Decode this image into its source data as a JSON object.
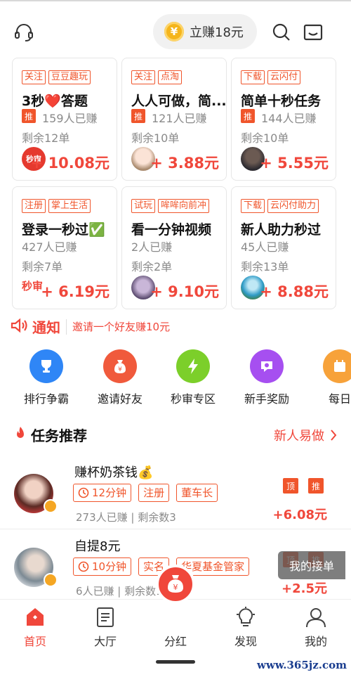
{
  "header": {
    "earn_label": "立赚18元",
    "coin_symbol": "¥"
  },
  "cards": [
    {
      "tags": [
        "关注",
        "豆豆趣玩"
      ],
      "title": "3秒❤️答题",
      "flag": "推",
      "earned": "159人已赚",
      "remaining": "剩余12单",
      "avatar_text": "秒审",
      "price": "+ 10.08元"
    },
    {
      "tags": [
        "关注",
        "点淘"
      ],
      "title": "人人可做，简...",
      "flag": "推",
      "earned": "121人已赚",
      "remaining": "剩余10单",
      "price": "+ 3.88元"
    },
    {
      "tags": [
        "下载",
        "云闪付"
      ],
      "title": "简单十秒任务",
      "flag": "推",
      "earned": "144人已赚",
      "remaining": "剩余10单",
      "price": "+ 5.55元"
    },
    {
      "tags": [
        "注册",
        "掌上生活"
      ],
      "title": "登录一秒过✅",
      "earned": "427人已赚",
      "remaining": "剩余7单",
      "avatar_text": "秒审",
      "price": "+ 6.19元"
    },
    {
      "tags": [
        "试玩",
        "哞哞向前冲"
      ],
      "title": "看一分钟视频",
      "earned": "2人已赚",
      "remaining": "剩余2单",
      "price": "+ 9.10元"
    },
    {
      "tags": [
        "下载",
        "云闪付助力"
      ],
      "title": "新人助力秒过",
      "earned": "45人已赚",
      "remaining": "剩余13单",
      "price": "+ 8.88元"
    }
  ],
  "notice": {
    "title": "通知",
    "text": "邀请一个好友赚10元"
  },
  "quick_nav": [
    {
      "label": "排行争霸",
      "color": "#2f86f6"
    },
    {
      "label": "邀请好友",
      "color": "#f05a3c"
    },
    {
      "label": "秒审专区",
      "color": "#7ccf2a"
    },
    {
      "label": "新手奖励",
      "color": "#a64ff0"
    },
    {
      "label": "每日",
      "color": "#f7a23a"
    }
  ],
  "section": {
    "title": "任务推荐",
    "more": "新人易做"
  },
  "tasks": [
    {
      "name": "赚杯奶茶钱💰",
      "time": "12分钟",
      "tags": [
        "注册",
        "董车长"
      ],
      "meta": "273人已赚 | 剩余数3",
      "flags": [
        "顶",
        "推"
      ],
      "price": "+6.08元"
    },
    {
      "name": "自提8元",
      "time": "10分钟",
      "tags": [
        "实名",
        "华夏基金管家"
      ],
      "meta": "6人已赚 | 剩余数1",
      "flags": [
        "顶",
        "推"
      ],
      "price": "+2.5元"
    }
  ],
  "floating": {
    "my_orders": "我的接单"
  },
  "bottom_nav": {
    "tabs": [
      "首页",
      "大厅",
      "分红",
      "发现",
      "我的"
    ],
    "active": "首页",
    "center_symbol": "¥"
  },
  "watermark": "www.365jz.com",
  "colors": {
    "accent": "#f0473b",
    "tag": "#f0552b"
  }
}
